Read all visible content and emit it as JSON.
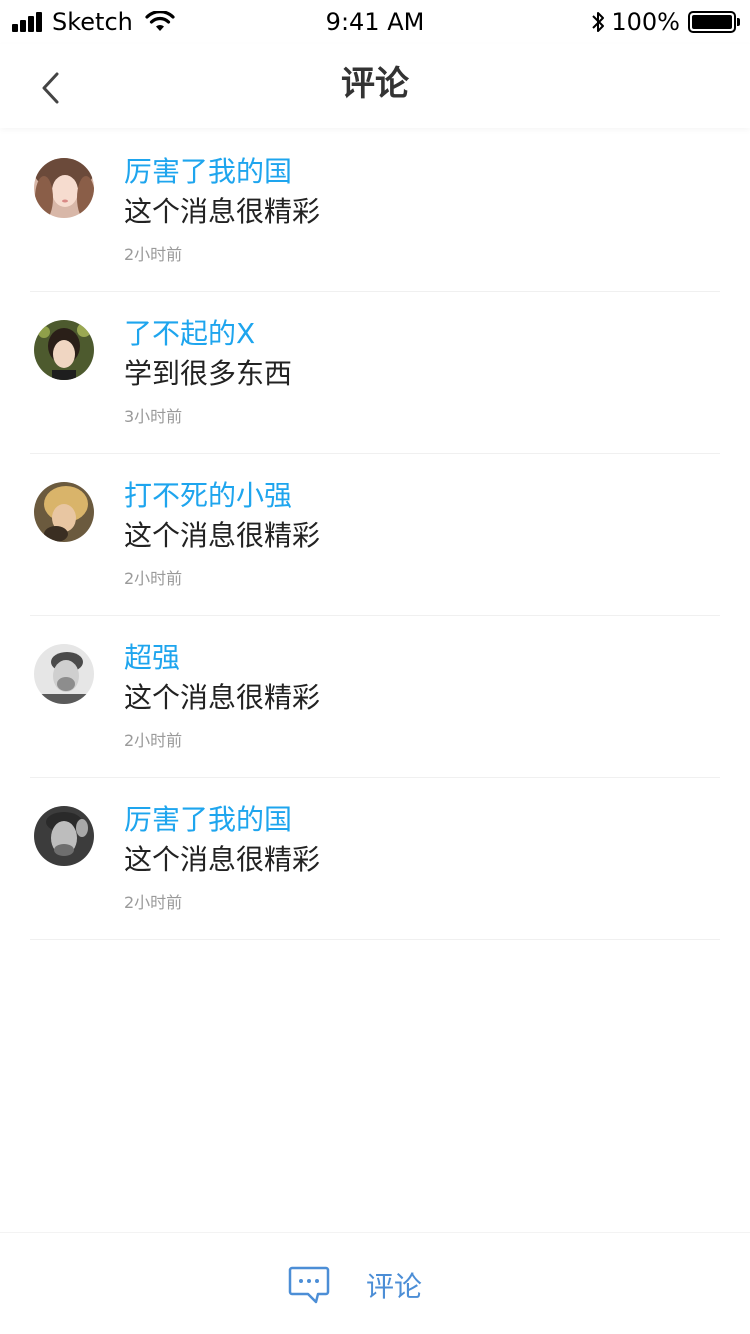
{
  "status_bar": {
    "carrier": "Sketch",
    "time": "9:41 AM",
    "battery": "100%"
  },
  "nav": {
    "title": "评论"
  },
  "comments": [
    {
      "user": "厉害了我的国",
      "text": "这个消息很精彩",
      "time": "2小时前"
    },
    {
      "user": "了不起的X",
      "text": "学到很多东西",
      "time": "3小时前"
    },
    {
      "user": "打不死的小强",
      "text": "这个消息很精彩",
      "time": "2小时前"
    },
    {
      "user": "超强",
      "text": "这个消息很精彩",
      "time": "2小时前"
    },
    {
      "user": "厉害了我的国",
      "text": "这个消息很精彩",
      "time": "2小时前"
    }
  ],
  "bottom_bar": {
    "comment_label": "评论"
  },
  "colors": {
    "username": "#1ea5ee",
    "action": "#4c8ed6",
    "time": "#9a9a9a"
  },
  "icons": {
    "back": "chevron-left-icon",
    "comment": "chat-bubble-icon"
  }
}
